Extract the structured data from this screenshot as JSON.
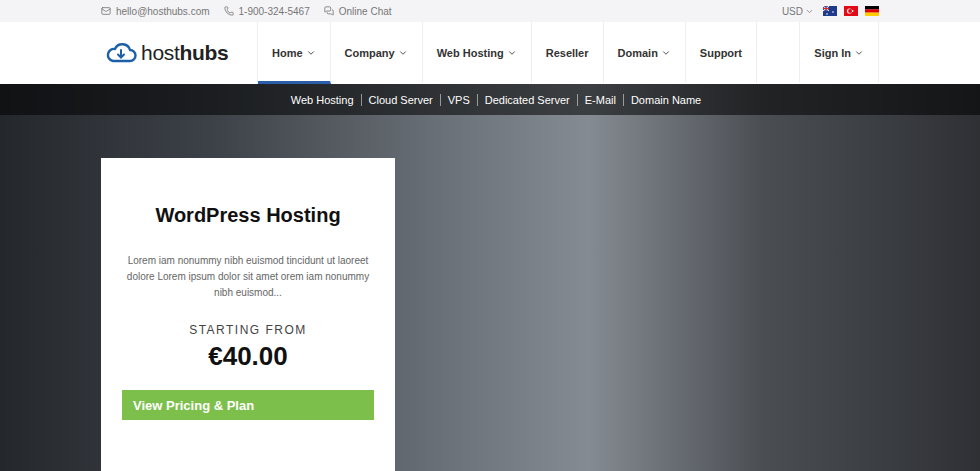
{
  "topbar": {
    "email": "hello@hosthubs.com",
    "phone": "1-900-324-5467",
    "chat": "Online Chat",
    "currency": {
      "label": "USD",
      "dropdown": true
    }
  },
  "logo": {
    "light": "host",
    "bold": "hubs"
  },
  "nav": {
    "items": [
      {
        "label": "Home",
        "dropdown": true,
        "selected": true
      },
      {
        "label": "Company",
        "dropdown": true,
        "selected": false
      },
      {
        "label": "Web Hosting",
        "dropdown": true,
        "selected": false
      },
      {
        "label": "Reseller",
        "dropdown": false,
        "selected": false
      },
      {
        "label": "Domain",
        "dropdown": true,
        "selected": false
      },
      {
        "label": "Support",
        "dropdown": false,
        "selected": false
      }
    ],
    "signin": {
      "label": "Sign In",
      "dropdown": true
    }
  },
  "subnav": [
    "Web Hosting",
    "Cloud Server",
    "VPS",
    "Dedicated Server",
    "E-Mail",
    "Domain Name"
  ],
  "promo": {
    "title": "WordPress Hosting",
    "description": "Lorem iam nonummy nibh euismod tincidunt ut laoreet dolore Lorem ipsum dolor sit amet orem iam nonummy nibh euismod...",
    "starting": "STARTING FROM",
    "price": "€40.00",
    "button": "View Pricing & Plan"
  }
}
